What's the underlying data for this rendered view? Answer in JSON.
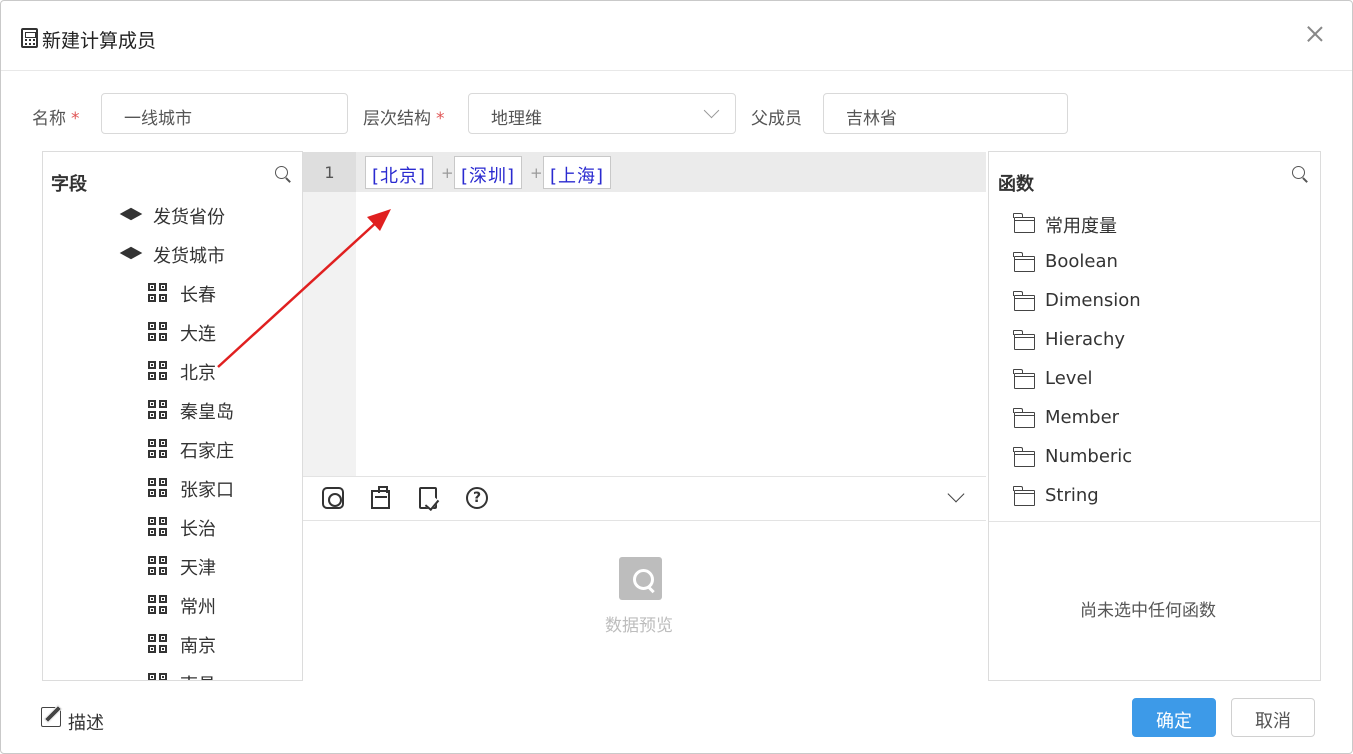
{
  "dialog": {
    "title": "新建计算成员"
  },
  "form": {
    "name_label": "名称",
    "name_value": "一线城市",
    "hierarchy_label": "层次结构",
    "hierarchy_value": "地理维",
    "parent_label": "父成员",
    "parent_value": "吉林省",
    "required_mark": "*"
  },
  "fields_panel": {
    "title": "字段",
    "levels": [
      {
        "label": "发货省份"
      },
      {
        "label": "发货城市"
      }
    ],
    "members": [
      {
        "label": "长春"
      },
      {
        "label": "大连"
      },
      {
        "label": "北京"
      },
      {
        "label": "秦皇岛"
      },
      {
        "label": "石家庄"
      },
      {
        "label": "张家口"
      },
      {
        "label": "长治"
      },
      {
        "label": "天津"
      },
      {
        "label": "常州"
      },
      {
        "label": "南京"
      },
      {
        "label": "南昌"
      }
    ]
  },
  "editor": {
    "line_number": "1",
    "tokens": [
      "[北京]",
      "[深圳]",
      "[上海]"
    ],
    "operator": "+"
  },
  "preview": {
    "placeholder": "数据预览"
  },
  "functions_panel": {
    "title": "函数",
    "categories": [
      {
        "label": "常用度量"
      },
      {
        "label": "Boolean"
      },
      {
        "label": "Dimension"
      },
      {
        "label": "Hierachy"
      },
      {
        "label": "Level"
      },
      {
        "label": "Member"
      },
      {
        "label": "Numberic"
      },
      {
        "label": "String"
      }
    ],
    "empty_text": "尚未选中任何函数"
  },
  "footer": {
    "describe_label": "描述",
    "confirm_label": "确定",
    "cancel_label": "取消"
  },
  "colors": {
    "primary": "#3d9ae8",
    "required": "#e05555",
    "token_text": "#2a2ad0",
    "annotation_arrow": "#e02020"
  },
  "icons": {
    "title": "calculator-icon",
    "close": "close-icon",
    "level": "layers-icon",
    "member": "qrcode-icon",
    "category": "folder-icon",
    "search": "search-icon",
    "describe": "edit-icon"
  }
}
